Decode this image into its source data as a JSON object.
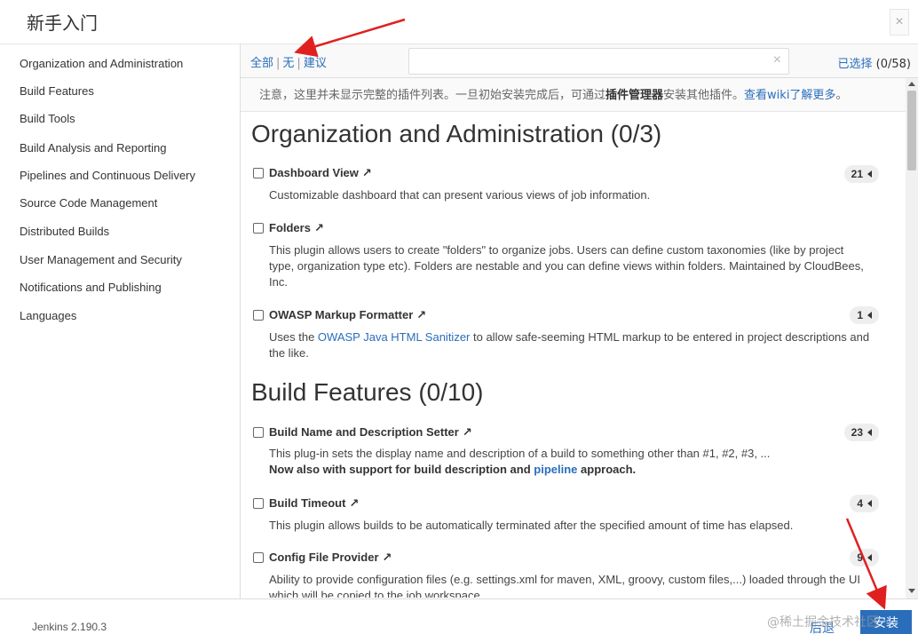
{
  "window": {
    "title": "新手入门",
    "close_glyph": "×"
  },
  "sidebar": {
    "items": [
      {
        "label": "Organization and Administration"
      },
      {
        "label": "Build Features"
      },
      {
        "label": "Build Tools"
      },
      {
        "label": "Build Analysis and Reporting"
      },
      {
        "label": "Pipelines and Continuous Delivery"
      },
      {
        "label": "Source Code Management"
      },
      {
        "label": "Distributed Builds"
      },
      {
        "label": "User Management and Security"
      },
      {
        "label": "Notifications and Publishing"
      },
      {
        "label": "Languages"
      }
    ]
  },
  "toolbar": {
    "filters": {
      "all": "全部",
      "none": "无",
      "suggested": "建议",
      "separator": "|"
    },
    "search": {
      "value": "",
      "placeholder": "",
      "clear_glyph": "×"
    },
    "selected_label": "已选择",
    "selected_count": "(0/58)"
  },
  "notice": {
    "prefix": "注意，这里并未显示完整的插件列表。一旦初始安装完成后，可通过",
    "plugin_manager": "插件管理器",
    "middle": "安装其他插件。",
    "wiki_link": "查看wiki了解更多",
    "suffix": "。"
  },
  "sections": [
    {
      "title": "Organization and Administration (0/3)",
      "plugins": [
        {
          "name": "Dashboard View",
          "deps": "21",
          "desc": "Customizable dashboard that can present various views of job information."
        },
        {
          "name": "Folders",
          "deps": "",
          "desc_line1": "This plugin allows users to create \"folders\" to organize jobs. Users can define custom taxonomies (like by project",
          "desc_line2": "type, organization type etc). Folders are nestable and you can define views within folders. Maintained by CloudBees,",
          "desc_line3": "Inc."
        },
        {
          "name": "OWASP Markup Formatter",
          "deps": "1",
          "desc_prefix": "Uses the ",
          "desc_link": "OWASP Java HTML Sanitizer",
          "desc_suffix": " to allow safe-seeming HTML markup to be entered in project descriptions and",
          "desc_line2": "the like."
        }
      ]
    },
    {
      "title": "Build Features (0/10)",
      "plugins": [
        {
          "name": "Build Name and Description Setter",
          "deps": "23",
          "desc": "This plug-in sets the display name and description of a build to something other than #1, #2, #3, ...",
          "desc_bold_prefix": "Now also with support for build description and ",
          "desc_bold_link": "pipeline",
          "desc_bold_suffix": " approach."
        },
        {
          "name": "Build Timeout",
          "deps": "4",
          "desc": "This plugin allows builds to be automatically terminated after the specified amount of time has elapsed."
        },
        {
          "name": "Config File Provider",
          "deps": "9",
          "desc": "Ability to provide configuration files (e.g. settings.xml for maven, XML, groovy, custom files,...) loaded through the UI",
          "desc_line2": "which will be copied to the job workspace."
        }
      ]
    }
  ],
  "icons": {
    "external": "↗"
  },
  "footer": {
    "version": "Jenkins 2.190.3",
    "back": "后退",
    "install": "安装",
    "watermark": "@稀土掘金技术社区"
  },
  "colors": {
    "accent": "#2a6ebb",
    "annotation": "#e02020"
  }
}
